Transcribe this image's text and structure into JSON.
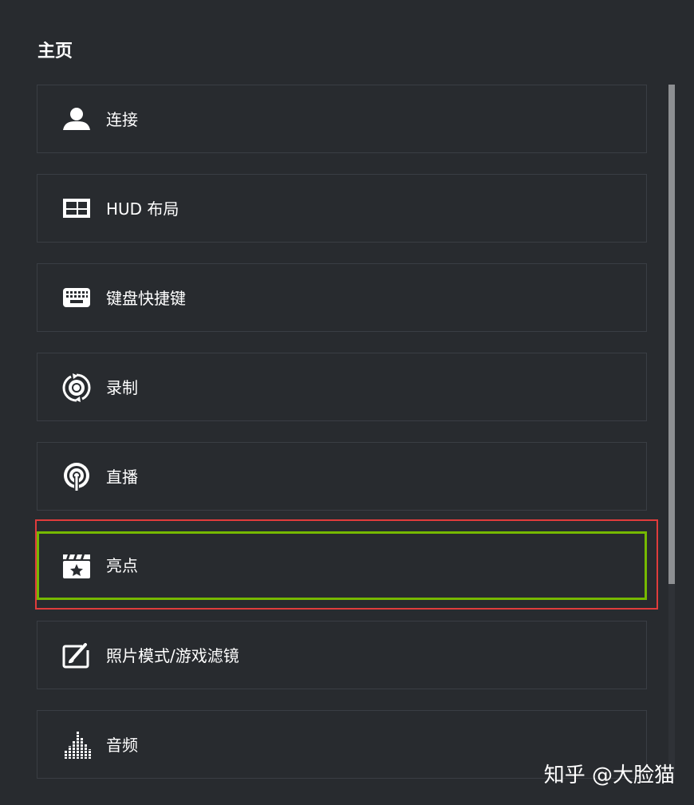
{
  "header": {
    "title": "主页"
  },
  "menu": {
    "items": [
      {
        "label": "连接",
        "icon": "user-icon"
      },
      {
        "label": "HUD 布局",
        "icon": "hud-layout-icon"
      },
      {
        "label": "键盘快捷键",
        "icon": "keyboard-icon"
      },
      {
        "label": "录制",
        "icon": "record-icon"
      },
      {
        "label": "直播",
        "icon": "broadcast-icon"
      },
      {
        "label": "亮点",
        "icon": "highlights-icon",
        "selected": true
      },
      {
        "label": "照片模式/游戏滤镜",
        "icon": "photo-mode-icon"
      },
      {
        "label": "音频",
        "icon": "audio-icon"
      }
    ]
  },
  "watermark": {
    "text": "知乎 @大脸猫"
  },
  "colors": {
    "background": "#282b2f",
    "item_border": "#3a3e44",
    "selected_border": "#76b900",
    "annotation_border": "#e03c3c",
    "scrollbar_thumb": "#8d8f92"
  }
}
